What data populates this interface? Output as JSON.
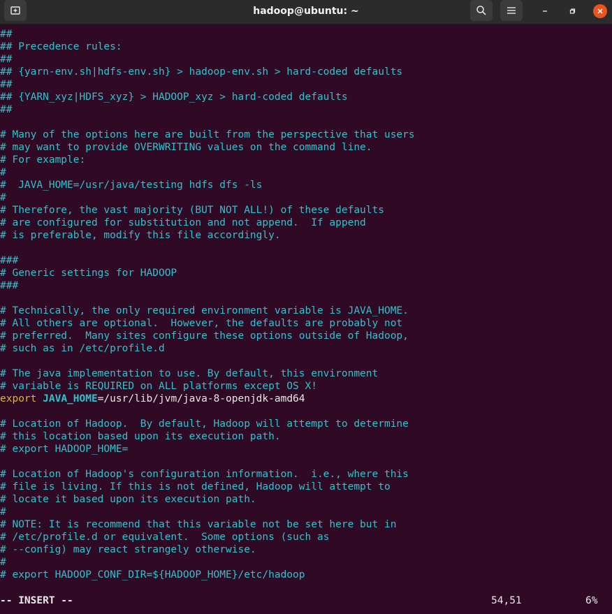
{
  "window": {
    "title": "hadoop@ubuntu: ~"
  },
  "icons": {
    "new_tab": "new-tab-icon",
    "search": "search-icon",
    "menu": "hamburger-menu-icon",
    "minimize": "minimize-icon",
    "maximize": "maximize-icon",
    "close": "close-icon"
  },
  "colors": {
    "background": "#300a24",
    "comment": "#2ec3cc",
    "keyword": "#d8b63a",
    "close": "#e95420"
  },
  "lines": [
    "##",
    "## Precedence rules:",
    "##",
    "## {yarn-env.sh|hdfs-env.sh} > hadoop-env.sh > hard-coded defaults",
    "##",
    "## {YARN_xyz|HDFS_xyz} > HADOOP_xyz > hard-coded defaults",
    "##",
    "",
    "# Many of the options here are built from the perspective that users",
    "# may want to provide OVERWRITING values on the command line.",
    "# For example:",
    "#",
    "#  JAVA_HOME=/usr/java/testing hdfs dfs -ls",
    "#",
    "# Therefore, the vast majority (BUT NOT ALL!) of these defaults",
    "# are configured for substitution and not append.  If append",
    "# is preferable, modify this file accordingly.",
    "",
    "###",
    "# Generic settings for HADOOP",
    "###",
    "",
    "# Technically, the only required environment variable is JAVA_HOME.",
    "# All others are optional.  However, the defaults are probably not",
    "# preferred.  Many sites configure these options outside of Hadoop,",
    "# such as in /etc/profile.d",
    "",
    "# The java implementation to use. By default, this environment",
    "# variable is REQUIRED on ALL platforms except OS X!",
    {
      "export": "export",
      "name": "JAVA_HOME",
      "value": "=/usr/lib/jvm/java-8-openjdk-amd64"
    },
    "",
    "# Location of Hadoop.  By default, Hadoop will attempt to determine",
    "# this location based upon its execution path.",
    "# export HADOOP_HOME=",
    "",
    "# Location of Hadoop's configuration information.  i.e., where this",
    "# file is living. If this is not defined, Hadoop will attempt to",
    "# locate it based upon its execution path.",
    "#",
    "# NOTE: It is recommend that this variable not be set here but in",
    "# /etc/profile.d or equivalent.  Some options (such as",
    "# --config) may react strangely otherwise.",
    "#",
    "# export HADOOP_CONF_DIR=${HADOOP_HOME}/etc/hadoop"
  ],
  "status": {
    "mode": "-- INSERT --",
    "position": "54,51",
    "percent": "6%"
  }
}
